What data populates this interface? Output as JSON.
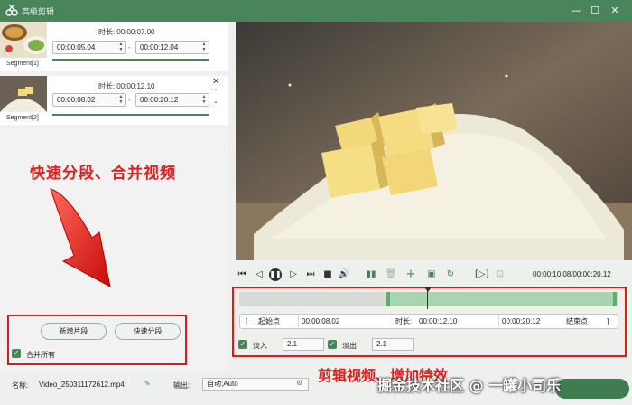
{
  "window": {
    "title": "高级剪辑",
    "minimize": "—",
    "maximize": "☐",
    "close": "✕"
  },
  "segments": [
    {
      "label": "Segment[1]",
      "duration_label": "时长:",
      "duration": "00:00:07.00",
      "start": "00:00:05.04",
      "end": "00:00:12.04"
    },
    {
      "label": "Segment[2]",
      "duration_label": "时长:",
      "duration": "00:00:12.10",
      "start": "00:00:08.02",
      "end": "00:00:20.12"
    }
  ],
  "annotations": {
    "left": "快速分段、合并视频",
    "right": "剪辑视频、增加特效"
  },
  "left_actions": {
    "add_segment": "新增片段",
    "quick_split": "快速分段",
    "merge_all": "合并所有"
  },
  "player": {
    "time": "00:00:10.08/00:00:20.12"
  },
  "cut": {
    "start_button": "起始点",
    "start_value": "00:00:08.02",
    "duration_label": "时长:",
    "duration_value": "00:00:12.10",
    "end_value": "00:00:20.12",
    "end_button": "结束点",
    "bracket_left": "[",
    "bracket_right": "]"
  },
  "fade": {
    "in_label": "淡入",
    "in_value": "2.1",
    "out_label": "淡出",
    "out_value": "2.1"
  },
  "bottom": {
    "name_label": "名称:",
    "name_value": "Video_250311172612.mp4",
    "output_label": "输出:",
    "output_value": "自动;Auto"
  },
  "watermark": "掘金技术社区 @ 一罐小司乐",
  "colors": {
    "accent": "#49845a",
    "annotation": "#e02020"
  }
}
